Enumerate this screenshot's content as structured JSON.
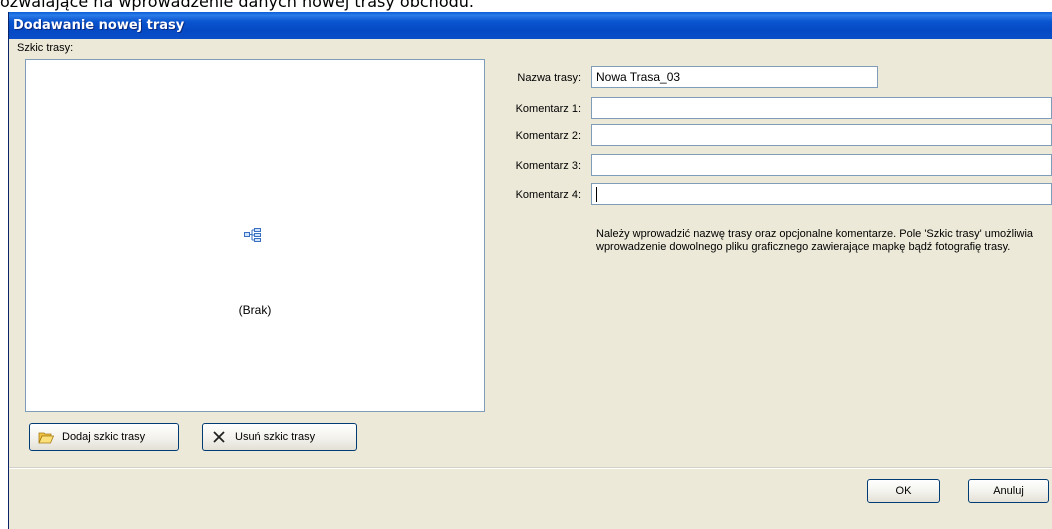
{
  "caption": "ozwalające na wprowadzenie danych nowej trasy obchodu.",
  "window": {
    "title": "Dodawanie nowej trasy"
  },
  "sketch": {
    "label": "Szkic trasy:",
    "empty_text": "(Brak)",
    "icon": "tree-structure-icon"
  },
  "buttons": {
    "add_sketch": {
      "label": "Dodaj szkic trasy",
      "icon": "open-folder-icon"
    },
    "remove_sketch": {
      "label": "Usuń szkic trasy",
      "icon": "x-delete-icon"
    },
    "ok": "OK",
    "cancel": "Anuluj"
  },
  "form": {
    "name_label": "Nazwa trasy:",
    "name_value": "Nowa Trasa_03",
    "comment1_label": "Komentarz 1:",
    "comment1_value": "",
    "comment2_label": "Komentarz 2:",
    "comment2_value": "",
    "comment3_label": "Komentarz 3:",
    "comment3_value": "",
    "comment4_label": "Komentarz 4:",
    "comment4_value": ""
  },
  "hint": "Należy wprowadzić nazwę trasy oraz opcjonalne komentarze.  Pole 'Szkic trasy' umożliwia wprowadzenie dowolnego pliku graficznego zawierające mapkę bądź fotografię trasy.",
  "colors": {
    "titlebar": "#0549c4",
    "dialog_bg": "#ece9d8",
    "field_border": "#7f9db9",
    "button_border": "#003c74"
  }
}
